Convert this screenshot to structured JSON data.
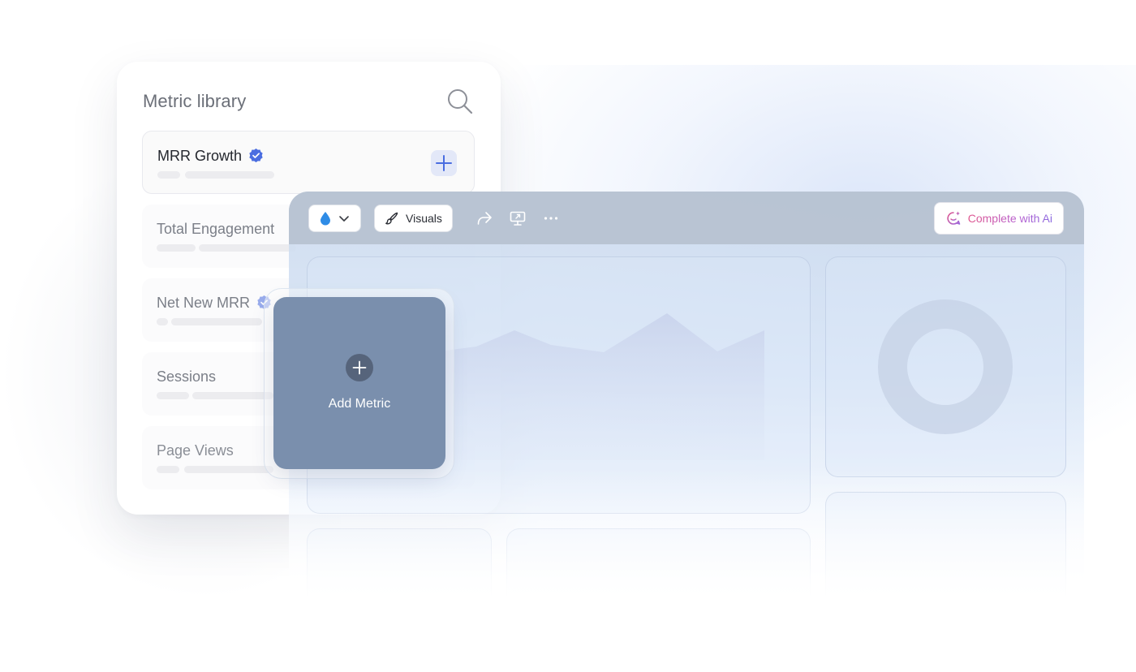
{
  "library": {
    "title": "Metric library",
    "metrics": [
      {
        "name": "MRR Growth",
        "verified": true,
        "state": "active"
      },
      {
        "name": "Total Engagement",
        "verified": false,
        "state": "dim"
      },
      {
        "name": "Net New MRR",
        "verified": true,
        "state": "dim"
      },
      {
        "name": "Sessions",
        "verified": false,
        "state": "dim"
      },
      {
        "name": "Page Views",
        "verified": false,
        "state": "dim2"
      }
    ]
  },
  "toolbar": {
    "color_icon": "droplet-icon",
    "visuals_label": "Visuals",
    "ai_label": "Complete with Ai"
  },
  "add_metric": {
    "label": "Add Metric"
  },
  "colors": {
    "accent": "#4a6de0",
    "verified": "#4a6de0",
    "add_card": "#7a8fad",
    "toolbar": "#b6c1d0"
  }
}
